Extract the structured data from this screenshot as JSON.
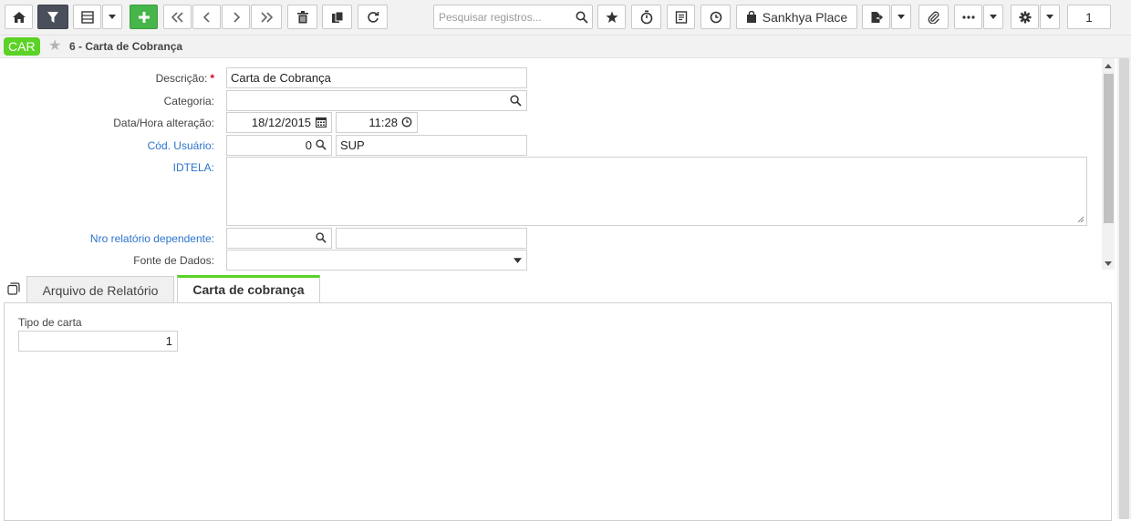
{
  "toolbar": {
    "search_placeholder": "Pesquisar registros...",
    "place_label": "Sankhya Place",
    "page_number": "1",
    "accent_green": "#46b54a",
    "filter_dark": "#4a4f5c"
  },
  "header": {
    "badge": "CAR",
    "title": "6 - Carta de Cobrança",
    "badge_color": "#5bd226"
  },
  "form": {
    "descricao": {
      "label": "Descrição:",
      "required": "*",
      "value": "Carta de Cobrança"
    },
    "categoria": {
      "label": "Categoria:",
      "value": ""
    },
    "data_hora": {
      "label": "Data/Hora alteração:",
      "date": "18/12/2015",
      "time": "11:28"
    },
    "cod_usuario": {
      "label": "Cód. Usuário:",
      "value": "0",
      "name": "SUP"
    },
    "idtela": {
      "label": "IDTELA:",
      "value": ""
    },
    "nro_relatorio": {
      "label": "Nro relatório dependente:",
      "value": "",
      "desc": ""
    },
    "fonte_dados": {
      "label": "Fonte de Dados:",
      "value": ""
    }
  },
  "tabs": [
    {
      "label": "Arquivo de Relatório"
    },
    {
      "label": "Carta de cobrança"
    }
  ],
  "panel": {
    "tipo_carta_label": "Tipo de carta",
    "tipo_carta_value": "1"
  }
}
